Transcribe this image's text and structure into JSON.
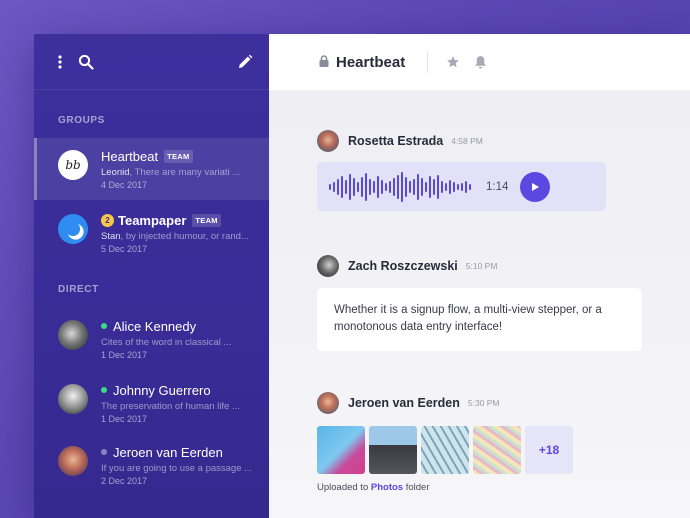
{
  "sidebar": {
    "groups_title": "GROUPS",
    "direct_title": "DIRECT",
    "groups": [
      {
        "name": "Heartbeat",
        "badge": "TEAM",
        "sender": "Leonid",
        "preview": ", There are many variati ...",
        "date": "4 Dec 2017",
        "avatar_text": "bb",
        "active": true
      },
      {
        "name": "Teampaper",
        "badge": "TEAM",
        "unread": "2",
        "sender": "Stan",
        "preview": ", by injected humour, or rand...",
        "date": "5 Dec 2017"
      }
    ],
    "direct": [
      {
        "name": "Alice Kennedy",
        "status_color": "#3ddc84",
        "preview": "Cites of the word in classical ...",
        "date": "1 Dec 2017"
      },
      {
        "name": "Johnny Guerrero",
        "status_color": "#3ddc84",
        "preview": "The preservation of human life ...",
        "date": "1 Dec 2017"
      },
      {
        "name": "Jeroen van Eerden",
        "status_color": "#8a82c8",
        "preview": "If you are going to use a passage ...",
        "date": "2 Dec 2017"
      }
    ]
  },
  "header": {
    "channel_name": "Heartbeat"
  },
  "messages": [
    {
      "author": "Rosetta Estrada",
      "time": "4:58 PM",
      "voice_duration": "1:14"
    },
    {
      "author": "Zach Roszczewski",
      "time": "5:10 PM",
      "text": "Whether it is a signup flow, a multi-view stepper, or a monotonous data entry interface!"
    },
    {
      "author": "Jeroen van Eerden",
      "time": "5:30 PM",
      "more_count": "+18",
      "upload_prefix": "Uploaded to ",
      "upload_link": "Photos",
      "upload_suffix": " folder"
    }
  ],
  "colors": {
    "accent": "#5b48e0",
    "sidebar": "#3a2c97",
    "online": "#3ddc84",
    "unread_badge": "#f6c945"
  }
}
